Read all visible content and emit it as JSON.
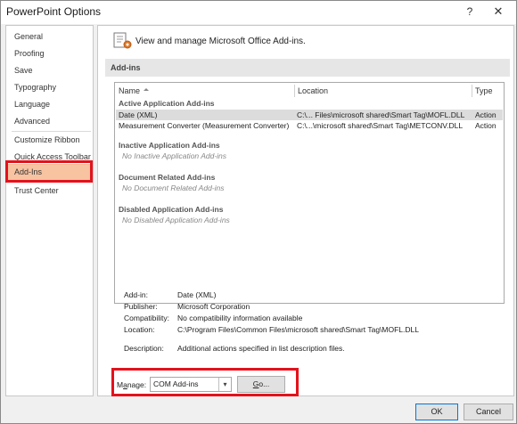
{
  "window": {
    "title": "PowerPoint Options",
    "help": "?",
    "close": "✕"
  },
  "sidebar": {
    "items": [
      {
        "label": "General"
      },
      {
        "label": "Proofing"
      },
      {
        "label": "Save"
      },
      {
        "label": "Typography"
      },
      {
        "label": "Language"
      },
      {
        "label": "Advanced"
      },
      {
        "label": "Customize Ribbon"
      },
      {
        "label": "Quick Access Toolbar"
      },
      {
        "label": "Add-Ins"
      },
      {
        "label": "Trust Center"
      }
    ],
    "selected": "Add-Ins"
  },
  "content": {
    "header": "View and manage Microsoft Office Add-ins.",
    "section": "Add-ins",
    "table": {
      "columns": [
        "Name",
        "Location",
        "Type"
      ],
      "groups": [
        {
          "title": "Active Application Add-ins",
          "rows": [
            {
              "name": "Date (XML)",
              "location": "C:\\... Files\\microsoft shared\\Smart Tag\\MOFL.DLL",
              "type": "Action"
            },
            {
              "name": "Measurement Converter (Measurement Converter)",
              "location": "C:\\...\\microsoft shared\\Smart Tag\\METCONV.DLL",
              "type": "Action"
            }
          ]
        },
        {
          "title": "Inactive Application Add-ins",
          "empty": "No Inactive Application Add-ins"
        },
        {
          "title": "Document Related Add-ins",
          "empty": "No Document Related Add-ins"
        },
        {
          "title": "Disabled Application Add-ins",
          "empty": "No Disabled Application Add-ins"
        }
      ]
    },
    "details": {
      "addin_label": "Add-in:",
      "addin_value": "Date (XML)",
      "publisher_label": "Publisher:",
      "publisher_value": "Microsoft Corporation",
      "compat_label": "Compatibility:",
      "compat_value": "No compatibility information available",
      "location_label": "Location:",
      "location_value": "C:\\Program Files\\Common Files\\microsoft shared\\Smart Tag\\MOFL.DLL",
      "description_label": "Description:",
      "description_value": "Additional actions specified in list description files."
    },
    "manage": {
      "label_prefix": "M",
      "label_underlined": "a",
      "label_suffix": "nage:",
      "selected": "COM Add-ins",
      "go_underlined": "G",
      "go_suffix": "o..."
    }
  },
  "buttons": {
    "ok": "OK",
    "cancel": "Cancel"
  },
  "colors": {
    "selected_sidebar": "#f8c3a1",
    "highlight": "#e3121c",
    "ok_border": "#0078d7"
  }
}
